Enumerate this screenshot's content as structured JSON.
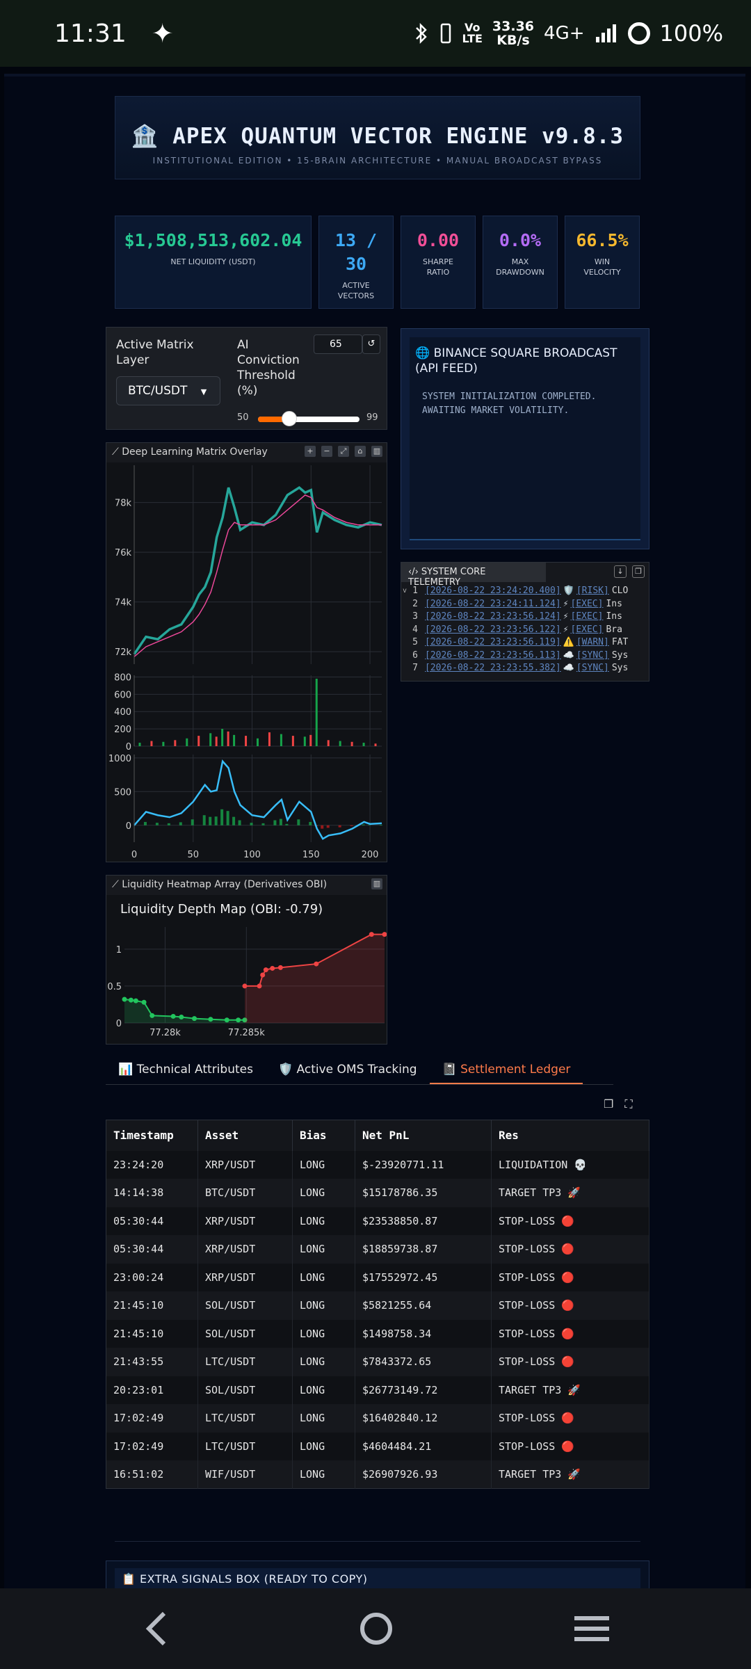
{
  "status_bar": {
    "time": "11:31",
    "star": "✦",
    "volte": [
      "Vo",
      "LTE"
    ],
    "speed": [
      "33.36",
      "KB/s"
    ],
    "network": "4G+",
    "battery": "100%"
  },
  "header": {
    "icon": "🏦",
    "title": "APEX QUANTUM VECTOR ENGINE v9.8.3",
    "subtitle": "INSTITUTIONAL EDITION • 15-BRAIN ARCHITECTURE • MANUAL BROADCAST BYPASS"
  },
  "kpis": [
    {
      "value": "$1,508,513,602.04",
      "label": "NET LIQUIDITY (USDT)",
      "color": "#27c993"
    },
    {
      "value": "13 / 30",
      "label": "ACTIVE VECTORS",
      "color": "#3da9f5"
    },
    {
      "value": "0.00",
      "label": "SHARPE RATIO",
      "color": "#f24f97"
    },
    {
      "value": "0.0%",
      "label": "MAX DRAWDOWN",
      "color": "#b46cf5"
    },
    {
      "value": "66.5%",
      "label": "WIN VELOCITY",
      "color": "#f5b82e"
    }
  ],
  "controls": {
    "matrix_label": "Active Matrix Layer",
    "pair": "BTC/USDT",
    "threshold_label": "AI Conviction Threshold (%)",
    "threshold_value": "65",
    "slider_min": "50",
    "slider_max": "99",
    "slider_fraction": 0.31
  },
  "broadcast": {
    "title": "🌐 BINANCE SQUARE BROADCAST (API FEED)",
    "message": "SYSTEM INITIALIZATION COMPLETED. AWAITING MARKET VOLATILITY."
  },
  "matrix_chart": {
    "title": "Deep Learning Matrix Overlay"
  },
  "telemetry": {
    "title": "SYSTEM CORE TELEMETRY",
    "lines": [
      {
        "n": "1",
        "ts": "[2026-08-22 23:24:20.400]",
        "icon": "🛡️",
        "tag": "[RISK]",
        "msg": "CLO"
      },
      {
        "n": "2",
        "ts": "[2026-08-22 23:24:11.124]",
        "icon": "⚡",
        "tag": "[EXEC]",
        "msg": "Ins"
      },
      {
        "n": "3",
        "ts": "[2026-08-22 23:23:56.124]",
        "icon": "⚡",
        "tag": "[EXEC]",
        "msg": "Ins"
      },
      {
        "n": "4",
        "ts": "[2026-08-22 23:23:56.122]",
        "icon": "⚡",
        "tag": "[EXEC]",
        "msg": "Bra"
      },
      {
        "n": "5",
        "ts": "[2026-08-22 23:23:56.119]",
        "icon": "⚠️",
        "tag": "[WARN]",
        "msg": "FAT"
      },
      {
        "n": "6",
        "ts": "[2026-08-22 23:23:56.113]",
        "icon": "☁️",
        "tag": "[SYNC]",
        "msg": "Sys"
      },
      {
        "n": "7",
        "ts": "[2026-08-22 23:23:55.382]",
        "icon": "☁️",
        "tag": "[SYNC]",
        "msg": "Sys"
      }
    ]
  },
  "heatmap": {
    "title": "Liquidity Heatmap Array (Derivatives OBI)"
  },
  "tabs": [
    {
      "label": "📊 Technical Attributes"
    },
    {
      "label": "🛡️ Active OMS Tracking"
    },
    {
      "label": "📓 Settlement Ledger"
    }
  ],
  "ledger": {
    "headers": [
      "Timestamp",
      "Asset",
      "Bias",
      "Net PnL",
      "Res"
    ],
    "rows": [
      [
        "23:24:20",
        "XRP/USDT",
        "LONG",
        "$-23920771.11",
        "LIQUIDATION 💀"
      ],
      [
        "14:14:38",
        "BTC/USDT",
        "LONG",
        "$15178786.35",
        "TARGET TP3 🚀"
      ],
      [
        "05:30:44",
        "XRP/USDT",
        "LONG",
        "$23538850.87",
        "STOP-LOSS 🔴"
      ],
      [
        "05:30:44",
        "XRP/USDT",
        "LONG",
        "$18859738.87",
        "STOP-LOSS 🔴"
      ],
      [
        "23:00:24",
        "XRP/USDT",
        "LONG",
        "$17552972.45",
        "STOP-LOSS 🔴"
      ],
      [
        "21:45:10",
        "SOL/USDT",
        "LONG",
        "$5821255.64",
        "STOP-LOSS 🔴"
      ],
      [
        "21:45:10",
        "SOL/USDT",
        "LONG",
        "$1498758.34",
        "STOP-LOSS 🔴"
      ],
      [
        "21:43:55",
        "LTC/USDT",
        "LONG",
        "$7843372.65",
        "STOP-LOSS 🔴"
      ],
      [
        "20:23:01",
        "SOL/USDT",
        "LONG",
        "$26773149.72",
        "TARGET TP3 🚀"
      ],
      [
        "17:02:49",
        "LTC/USDT",
        "LONG",
        "$16402840.12",
        "STOP-LOSS 🔴"
      ],
      [
        "17:02:49",
        "LTC/USDT",
        "LONG",
        "$4604484.21",
        "STOP-LOSS 🔴"
      ],
      [
        "16:51:02",
        "WIF/USDT",
        "LONG",
        "$26907926.93",
        "TARGET TP3 🚀"
      ]
    ]
  },
  "signals": {
    "title": "📋 EXTRA SIGNALS BOX (READY TO COPY)"
  },
  "chart_data": [
    {
      "type": "line",
      "title": "Deep Learning Matrix Overlay",
      "panel": "price",
      "y_ticks": [
        "72k",
        "74k",
        "76k",
        "78k"
      ],
      "ylim": [
        71500,
        79500
      ],
      "xlim": [
        0,
        210
      ],
      "x": [
        0,
        10,
        20,
        30,
        40,
        50,
        55,
        60,
        65,
        70,
        75,
        80,
        85,
        90,
        100,
        110,
        120,
        130,
        140,
        145,
        150,
        155,
        160,
        170,
        180,
        190,
        200,
        210
      ],
      "series": [
        {
          "values": [
            71900,
            72600,
            72500,
            72900,
            73100,
            73800,
            74300,
            74600,
            75200,
            76600,
            77400,
            78600,
            77800,
            76900,
            77200,
            77100,
            77500,
            78300,
            78600,
            78400,
            78500,
            76800,
            77600,
            77300,
            77100,
            77000,
            77200,
            77100
          ],
          "color": "#26a69a"
        },
        {
          "values": [
            71800,
            72200,
            72400,
            72600,
            72800,
            73200,
            73500,
            73900,
            74400,
            75200,
            76100,
            76900,
            77200,
            77100,
            77100,
            77100,
            77300,
            77700,
            78100,
            78300,
            78200,
            77800,
            77700,
            77400,
            77200,
            77100,
            77100,
            77100
          ],
          "color": "#ec4899"
        }
      ]
    },
    {
      "type": "bar",
      "panel": "volume",
      "y_ticks": [
        "0",
        "200",
        "400",
        "600",
        "800"
      ],
      "ylim": [
        0,
        820
      ],
      "xlim": [
        0,
        210
      ],
      "x": [
        5,
        15,
        25,
        35,
        45,
        55,
        65,
        70,
        75,
        80,
        85,
        95,
        105,
        115,
        125,
        135,
        145,
        150,
        155,
        165,
        175,
        185,
        195,
        205
      ],
      "values": [
        40,
        60,
        50,
        70,
        90,
        120,
        150,
        110,
        200,
        170,
        130,
        120,
        90,
        160,
        140,
        120,
        110,
        130,
        780,
        70,
        60,
        50,
        40,
        30
      ]
    },
    {
      "type": "line",
      "panel": "oscillator",
      "y_ticks": [
        "0",
        "500",
        "1000"
      ],
      "x_ticks": [
        "0",
        "50",
        "100",
        "150",
        "200"
      ],
      "ylim": [
        -250,
        1050
      ],
      "xlim": [
        0,
        210
      ],
      "x": [
        0,
        10,
        20,
        30,
        40,
        50,
        60,
        65,
        70,
        75,
        80,
        85,
        90,
        100,
        110,
        120,
        125,
        130,
        140,
        150,
        155,
        160,
        165,
        175,
        185,
        195,
        200,
        210
      ],
      "series": [
        {
          "values": [
            0,
            200,
            150,
            120,
            180,
            350,
            600,
            500,
            520,
            950,
            850,
            500,
            300,
            150,
            120,
            300,
            380,
            80,
            350,
            200,
            -50,
            -200,
            -150,
            -120,
            -50,
            50,
            20,
            30
          ],
          "color": "#38bdf8"
        }
      ]
    },
    {
      "type": "area",
      "title": "Liquidity Depth Map (OBI: -0.79)",
      "x_ticks": [
        "77.28k",
        "77.285k"
      ],
      "y_ticks": [
        "0",
        "0.5",
        "1"
      ],
      "ylim": [
        0,
        1.3
      ],
      "xlim": [
        77.2775,
        77.2935
      ],
      "series": [
        {
          "name": "bids",
          "color": "#22c55e",
          "x": [
            77.2775,
            77.2779,
            77.2782,
            77.2787,
            77.2792,
            77.2805,
            77.281,
            77.2818,
            77.2828,
            77.2838,
            77.2845,
            77.2849
          ],
          "values": [
            0.32,
            0.31,
            0.3,
            0.28,
            0.1,
            0.09,
            0.08,
            0.06,
            0.05,
            0.04,
            0.04,
            0.04
          ]
        },
        {
          "name": "asks",
          "color": "#ef4444",
          "x": [
            77.2849,
            77.2858,
            77.286,
            77.2862,
            77.2866,
            77.2871,
            77.2893,
            77.2927,
            77.2935
          ],
          "values": [
            0.5,
            0.5,
            0.65,
            0.72,
            0.74,
            0.75,
            0.8,
            1.2,
            1.2
          ]
        }
      ]
    }
  ]
}
